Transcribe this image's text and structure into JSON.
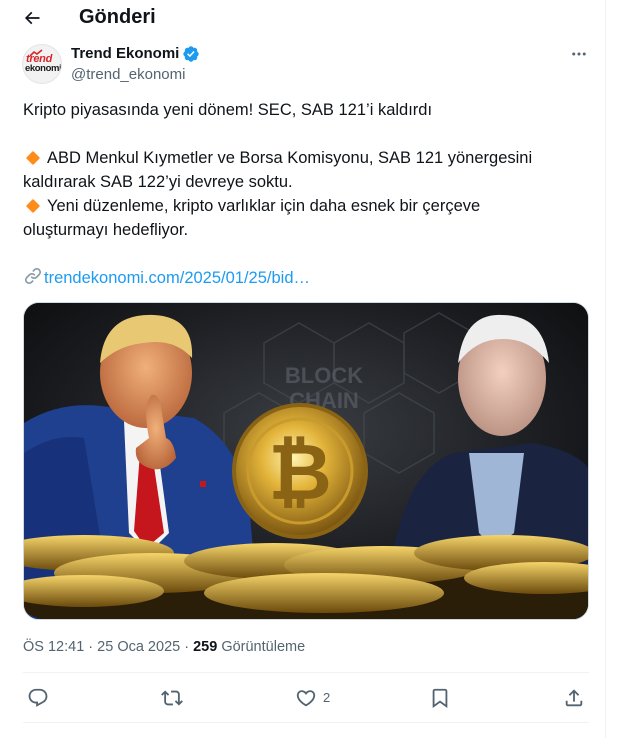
{
  "header": {
    "title": "Gönderi"
  },
  "author": {
    "name": "Trend Ekonomi",
    "handle": "@trend_ekonomi",
    "avatar_text_top": "trend",
    "avatar_text_bottom": "ekonomi",
    "verified": true
  },
  "tweet": {
    "line1": "Kripto piyasasında yeni dönem! SEC, SAB 121’i kaldırdı",
    "bullet1_a": "ABD Menkul Kıymetler ve Borsa Komisyonu, SAB 121 yönergesini",
    "bullet1_b": "kaldırarak SAB 122’yi devreye soktu.",
    "bullet2_a": "Yeni düzenleme, kripto varlıklar için daha esnek bir çerçeve",
    "bullet2_b": "oluşturmayı hedefliyor.",
    "link": "trendekonomi.com/2025/01/25/bid…",
    "bullet_color": "#ff8c1a"
  },
  "meta": {
    "time": "ÖS 12:41",
    "sep1": " · ",
    "date": "25 Oca 2025",
    "sep2": " · ",
    "views": "259",
    "views_label": " Görüntüleme"
  },
  "actions": {
    "reply_icon": "reply-icon",
    "retweet_icon": "retweet-icon",
    "like_icon": "heart-icon",
    "like_count": "2",
    "bookmark_icon": "bookmark-icon",
    "share_icon": "share-icon"
  },
  "media": {
    "watermark_line1": "BLOCK",
    "watermark_line2": "CHAIN"
  },
  "colors": {
    "link": "#1d9bf0",
    "verified": "#1d9bf0",
    "muted": "#536471",
    "text": "#0f1419"
  }
}
